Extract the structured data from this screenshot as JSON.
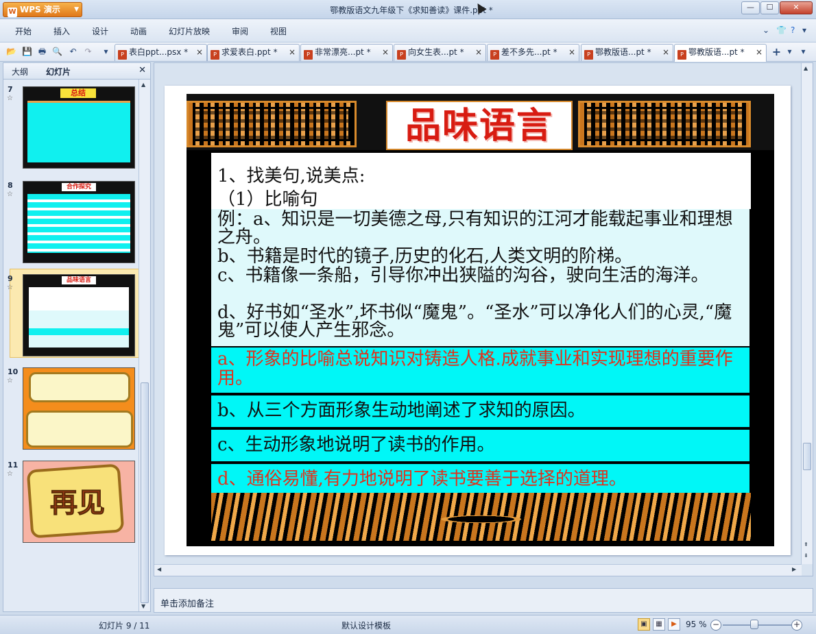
{
  "app": {
    "brand": "WPS 演示",
    "window_title": "鄂教版语文九年级下《求知善读》课件.ppt *"
  },
  "menu": [
    "开始",
    "插入",
    "设计",
    "动画",
    "幻灯片放映",
    "审阅",
    "视图"
  ],
  "tabs": [
    {
      "label": "表白ppt...psx *"
    },
    {
      "label": "求爱表白.ppt *"
    },
    {
      "label": "非常漂亮...pt *"
    },
    {
      "label": "向女生表...pt *"
    },
    {
      "label": "差不多先...pt *"
    },
    {
      "label": "鄂教版语...pt *"
    },
    {
      "label": "鄂教版语...pt *"
    }
  ],
  "panel": {
    "tab_outline": "大纲",
    "tab_slides": "幻灯片",
    "thumbnails": [
      {
        "num": "7",
        "title": "总结"
      },
      {
        "num": "8",
        "title": "合作探究"
      },
      {
        "num": "9",
        "title": "品味语言"
      },
      {
        "num": "10"
      },
      {
        "num": "11",
        "title": "再见"
      }
    ]
  },
  "slide": {
    "title": "品味语言",
    "line1": "1、找美句,说美点:",
    "line2": "（1）比喻句",
    "example_a": "例：a、知识是一切美德之母,只有知识的江河才能载起事业和理想之舟。",
    "example_b": "b、书籍是时代的镜子,历史的化石,人类文明的阶梯。",
    "example_c": "c、书籍像一条船，引导你冲出狭隘的沟谷，驶向生活的海洋。",
    "example_d": "d、好书如“圣水”,坏书似“魔鬼”。“圣水”可以净化人们的心灵,“魔鬼”可以使人产生邪念。",
    "answer_a": "a、形象的比喻总说知识对铸造人格.成就事业和实现理想的重要作用。",
    "answer_b": "b、从三个方面形象生动地阐述了求知的原因。",
    "answer_c": "c、生动形象地说明了读书的作用。",
    "answer_d": "d、通俗易懂,有力地说明了读书要善于选择的道理。"
  },
  "notes_placeholder": "单击添加备注",
  "status": {
    "slide_counter": "幻灯片 9 / 11",
    "template": "默认设计模板",
    "zoom": "95 %"
  },
  "colors": {
    "accent_red": "#e0321c",
    "highlight_cyan": "#00f7f7",
    "ornament_orange": "#d88a2c"
  }
}
